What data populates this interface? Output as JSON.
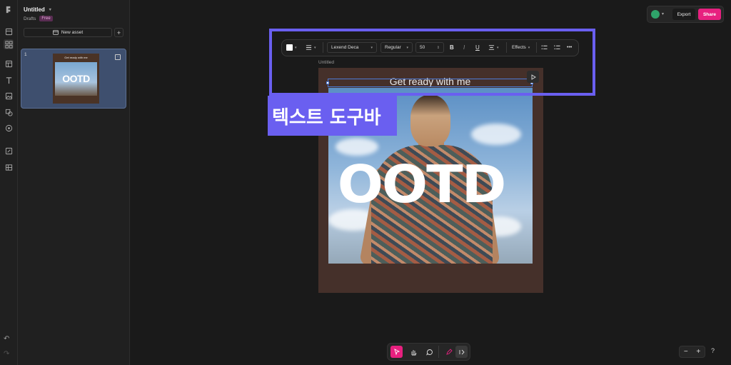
{
  "document": {
    "title": "Untitled",
    "location": "Drafts",
    "plan_badge": "Free"
  },
  "panel": {
    "new_asset_label": "New asset",
    "add_label": "+",
    "pages": [
      {
        "number": "1",
        "thumb_text": "Get ready with me",
        "thumb_big": "OOTD"
      }
    ]
  },
  "topbar": {
    "export_label": "Export",
    "share_label": "Share"
  },
  "frame": {
    "label": "Untitled",
    "headline": "Get ready with me",
    "big_text": "OOTD",
    "background_color": "#45302a"
  },
  "annotation": {
    "label": "텍스트 도구바",
    "color": "#6a5ff0"
  },
  "toolbar": {
    "font_family": "Lexend Deca",
    "font_weight": "Regular",
    "font_size": "50",
    "bold": "B",
    "italic": "I",
    "underline": "U",
    "effects_label": "Effects",
    "more": "•••"
  },
  "zoom": {
    "minus": "−",
    "plus": "+"
  },
  "help": "?",
  "colors": {
    "accent": "#e7207f",
    "selection": "#4d7bd6",
    "avatar": "#2fa36a"
  }
}
